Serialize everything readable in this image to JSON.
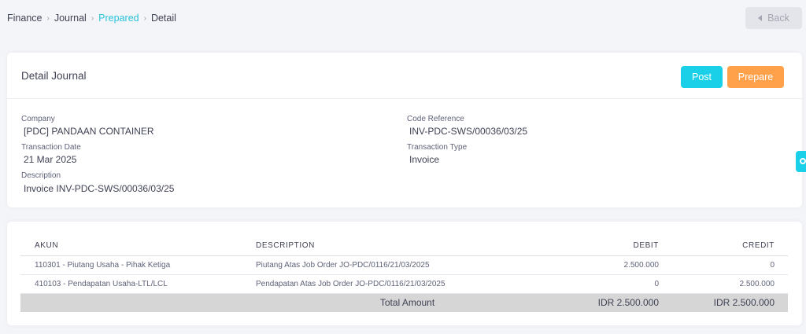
{
  "breadcrumb": {
    "items": [
      "Finance",
      "Journal",
      "Prepared",
      "Detail"
    ],
    "separator": "›",
    "active_color": "#2bc3dc"
  },
  "header": {
    "back_label": "Back"
  },
  "detail": {
    "title": "Detail Journal",
    "post_label": "Post",
    "prepare_label": "Prepare",
    "post_color": "#19d0e8",
    "prepare_color": "#ffa04b",
    "fields": {
      "company": {
        "label": "Company",
        "value": "[PDC] PANDAAN CONTAINER"
      },
      "code_reference": {
        "label": "Code Reference",
        "value": "INV-PDC-SWS/00036/03/25"
      },
      "transaction_date": {
        "label": "Transaction Date",
        "value": "21 Mar 2025"
      },
      "transaction_type": {
        "label": "Transaction Type",
        "value": "Invoice"
      },
      "description": {
        "label": "Description",
        "value": "Invoice INV-PDC-SWS/00036/03/25"
      }
    }
  },
  "side_tab": {
    "icon": "gear-icon"
  },
  "table": {
    "headers": {
      "akun": "AKUN",
      "description": "DESCRIPTION",
      "debit": "DEBIT",
      "credit": "CREDIT"
    },
    "rows": [
      {
        "akun": "110301 - Piutang Usaha - Pihak Ketiga",
        "description": "Piutang Atas Job Order JO-PDC/0116/21/03/2025",
        "debit": "2.500.000",
        "credit": "0"
      },
      {
        "akun": "410103 - Pendapatan Usaha-LTL/LCL",
        "description": "Pendapatan Atas Job Order JO-PDC/0116/21/03/2025",
        "debit": "0",
        "credit": "2.500.000"
      }
    ],
    "total": {
      "label": "Total Amount",
      "debit": "IDR 2.500.000",
      "credit": "IDR 2.500.000"
    }
  }
}
